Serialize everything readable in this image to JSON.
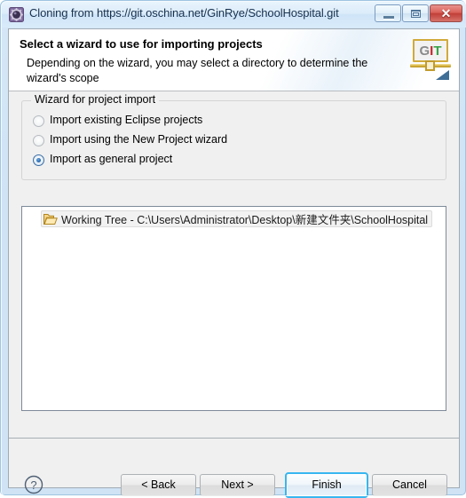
{
  "window": {
    "title": "Cloning from https://git.oschina.net/GinRye/SchoolHospital.git",
    "icon": "git-repository-icon",
    "controls": {
      "minimize_label": "–",
      "maximize_label": "□",
      "close_label": "✕"
    }
  },
  "header": {
    "title": "Select a wizard to use for importing projects",
    "description": "Depending on the wizard, you may select a directory to determine the wizard's scope",
    "banner_icon": {
      "name": "git-banner-icon",
      "letters": [
        "G",
        "I",
        "T"
      ],
      "letter_colors": [
        "#8a8a8a",
        "#c1272d",
        "#3aa44a"
      ],
      "frame_color": "#d1aa3a",
      "triangle_color": "#3f6e97"
    }
  },
  "group": {
    "legend": "Wizard for project import",
    "radios": [
      {
        "label": "Import existing Eclipse projects",
        "checked": false
      },
      {
        "label": "Import using the New Project wizard",
        "checked": false
      },
      {
        "label": "Import as general project",
        "checked": true
      }
    ]
  },
  "tree": {
    "items": [
      {
        "icon": "open-folder-icon",
        "label": "Working Tree - C:\\Users\\Administrator\\Desktop\\新建文件夹\\SchoolHospital",
        "selected": true
      }
    ]
  },
  "footer": {
    "help_label": "?",
    "buttons": [
      {
        "id": "back",
        "label": "< Back",
        "default": false,
        "enabled": true
      },
      {
        "id": "next",
        "label": "Next >",
        "default": false,
        "enabled": true
      },
      {
        "id": "finish",
        "label": "Finish",
        "default": true,
        "enabled": true
      },
      {
        "id": "cancel",
        "label": "Cancel",
        "default": false,
        "enabled": true
      }
    ]
  },
  "colors": {
    "titlebar_top": "#e9f4fd",
    "titlebar_bottom": "#d8ebfb",
    "dialog_background": "#f0f0f0",
    "header_background": "#ffffff",
    "close_button": "#c03f38",
    "focus_ring": "#37b6f0",
    "tree_background": "#ffffff"
  }
}
